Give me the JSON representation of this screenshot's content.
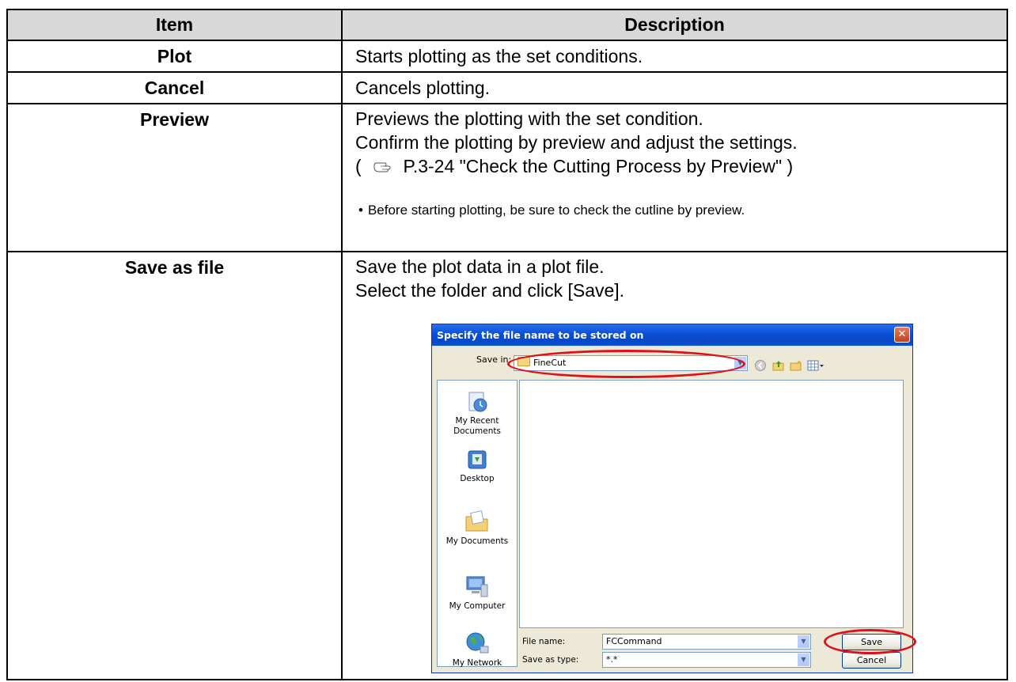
{
  "table": {
    "headers": {
      "item": "Item",
      "description": "Description"
    },
    "rows": [
      {
        "item": "Plot",
        "description": "Starts plotting as the set conditions."
      },
      {
        "item": "Cancel",
        "description": "Cancels plotting."
      },
      {
        "item": "Preview",
        "lines": [
          "Previews the plotting with the set condition.",
          "Confirm the plotting by preview and adjust the settings."
        ],
        "reference": "P.3-24 \"Check the Cutting Process by Preview\"",
        "ref_open": "(",
        "ref_close": ")",
        "note_bullet": "•",
        "note": "Before starting plotting, be sure to check the cutline by preview."
      },
      {
        "item": "Save as file",
        "lines": [
          "Save the plot data in a plot file.",
          "Select the folder and click [Save]."
        ]
      }
    ]
  },
  "dialog": {
    "title": "Specify the file name to be stored on",
    "close_glyph": "✕",
    "save_in_label": "Save in:",
    "save_in_value": "FineCut",
    "places": [
      {
        "label": "My Recent Documents",
        "icon": "recent-documents-icon"
      },
      {
        "label": "Desktop",
        "icon": "desktop-icon"
      },
      {
        "label": "My Documents",
        "icon": "my-documents-icon"
      },
      {
        "label": "My Computer",
        "icon": "my-computer-icon"
      },
      {
        "label": "My Network",
        "icon": "my-network-icon"
      }
    ],
    "file_name_label": "File name:",
    "file_name_value": "FCCommand",
    "save_type_label": "Save as type:",
    "save_type_value": "*.*",
    "save_button": "Save",
    "cancel_button": "Cancel",
    "dropdown_glyph": "▼",
    "highlight_color": "#e0101a"
  }
}
